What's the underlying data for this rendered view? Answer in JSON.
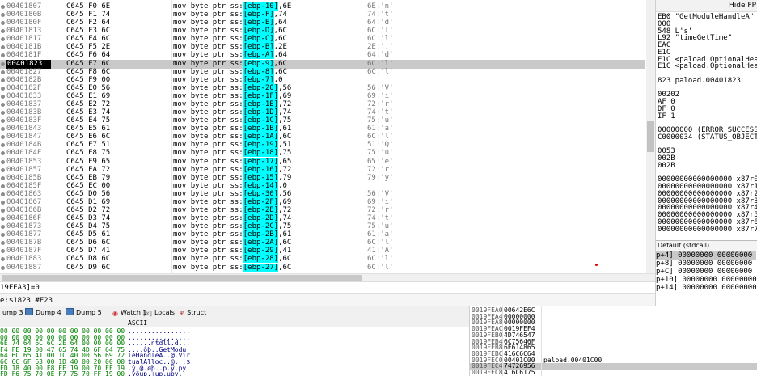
{
  "disasm": {
    "selected_index": 7,
    "rows": [
      {
        "addr": "00401807",
        "bytes": "C645 F0 6E",
        "mnemonic": "mov",
        "size": "byte ptr",
        "seg": "ss:",
        "reg": "[ebp-10]",
        "imm": ",6E",
        "comment": "6E:'n'"
      },
      {
        "addr": "0040180B",
        "bytes": "C645 F1 74",
        "mnemonic": "mov",
        "size": "byte ptr",
        "seg": "ss:",
        "reg": "[ebp-F]",
        "imm": ",74",
        "comment": "74:'t'"
      },
      {
        "addr": "0040180F",
        "bytes": "C645 F2 64",
        "mnemonic": "mov",
        "size": "byte ptr",
        "seg": "ss:",
        "reg": "[ebp-E]",
        "imm": ",64",
        "comment": "64:'d'"
      },
      {
        "addr": "00401813",
        "bytes": "C645 F3 6C",
        "mnemonic": "mov",
        "size": "byte ptr",
        "seg": "ss:",
        "reg": "[ebp-D]",
        "imm": ",6C",
        "comment": "6C:'l'"
      },
      {
        "addr": "00401817",
        "bytes": "C645 F4 6C",
        "mnemonic": "mov",
        "size": "byte ptr",
        "seg": "ss:",
        "reg": "[ebp-C]",
        "imm": ",6C",
        "comment": "6C:'l'"
      },
      {
        "addr": "0040181B",
        "bytes": "C645 F5 2E",
        "mnemonic": "mov",
        "size": "byte ptr",
        "seg": "ss:",
        "reg": "[ebp-B]",
        "imm": ",2E",
        "comment": "2E:'.'"
      },
      {
        "addr": "0040181F",
        "bytes": "C645 F6 64",
        "mnemonic": "mov",
        "size": "byte ptr",
        "seg": "ss:",
        "reg": "[ebp-A]",
        "imm": ",64",
        "comment": "64:'d'"
      },
      {
        "addr": "00401823",
        "bytes": "C645 F7 6C",
        "mnemonic": "mov",
        "size": "byte ptr",
        "seg": "ss:",
        "reg": "[ebp-9]",
        "imm": ",6C",
        "comment": "6C:'l'"
      },
      {
        "addr": "00401827",
        "bytes": "C645 F8 6C",
        "mnemonic": "mov",
        "size": "byte ptr",
        "seg": "ss:",
        "reg": "[ebp-8]",
        "imm": ",6C",
        "comment": "6C:'l'"
      },
      {
        "addr": "0040182B",
        "bytes": "C645 F9 00",
        "mnemonic": "mov",
        "size": "byte ptr",
        "seg": "ss:",
        "reg": "[ebp-7]",
        "imm": ",0",
        "comment": ""
      },
      {
        "addr": "0040182F",
        "bytes": "C645 E0 56",
        "mnemonic": "mov",
        "size": "byte ptr",
        "seg": "ss:",
        "reg": "[ebp-20]",
        "imm": ",56",
        "comment": "56:'V'"
      },
      {
        "addr": "00401833",
        "bytes": "C645 E1 69",
        "mnemonic": "mov",
        "size": "byte ptr",
        "seg": "ss:",
        "reg": "[ebp-1F]",
        "imm": ",69",
        "comment": "69:'i'"
      },
      {
        "addr": "00401837",
        "bytes": "C645 E2 72",
        "mnemonic": "mov",
        "size": "byte ptr",
        "seg": "ss:",
        "reg": "[ebp-1E]",
        "imm": ",72",
        "comment": "72:'r'"
      },
      {
        "addr": "0040183B",
        "bytes": "C645 E3 74",
        "mnemonic": "mov",
        "size": "byte ptr",
        "seg": "ss:",
        "reg": "[ebp-1D]",
        "imm": ",74",
        "comment": "74:'t'"
      },
      {
        "addr": "0040183F",
        "bytes": "C645 E4 75",
        "mnemonic": "mov",
        "size": "byte ptr",
        "seg": "ss:",
        "reg": "[ebp-1C]",
        "imm": ",75",
        "comment": "75:'u'"
      },
      {
        "addr": "00401843",
        "bytes": "C645 E5 61",
        "mnemonic": "mov",
        "size": "byte ptr",
        "seg": "ss:",
        "reg": "[ebp-1B]",
        "imm": ",61",
        "comment": "61:'a'"
      },
      {
        "addr": "00401847",
        "bytes": "C645 E6 6C",
        "mnemonic": "mov",
        "size": "byte ptr",
        "seg": "ss:",
        "reg": "[ebp-1A]",
        "imm": ",6C",
        "comment": "6C:'l'"
      },
      {
        "addr": "0040184B",
        "bytes": "C645 E7 51",
        "mnemonic": "mov",
        "size": "byte ptr",
        "seg": "ss:",
        "reg": "[ebp-19]",
        "imm": ",51",
        "comment": "51:'Q'"
      },
      {
        "addr": "0040184F",
        "bytes": "C645 E8 75",
        "mnemonic": "mov",
        "size": "byte ptr",
        "seg": "ss:",
        "reg": "[ebp-18]",
        "imm": ",75",
        "comment": "75:'u'"
      },
      {
        "addr": "00401853",
        "bytes": "C645 E9 65",
        "mnemonic": "mov",
        "size": "byte ptr",
        "seg": "ss:",
        "reg": "[ebp-17]",
        "imm": ",65",
        "comment": "65:'e'"
      },
      {
        "addr": "00401857",
        "bytes": "C645 EA 72",
        "mnemonic": "mov",
        "size": "byte ptr",
        "seg": "ss:",
        "reg": "[ebp-16]",
        "imm": ",72",
        "comment": "72:'r'"
      },
      {
        "addr": "0040185B",
        "bytes": "C645 EB 79",
        "mnemonic": "mov",
        "size": "byte ptr",
        "seg": "ss:",
        "reg": "[ebp-15]",
        "imm": ",79",
        "comment": "79:'y'"
      },
      {
        "addr": "0040185F",
        "bytes": "C645 EC 00",
        "mnemonic": "mov",
        "size": "byte ptr",
        "seg": "ss:",
        "reg": "[ebp-14]",
        "imm": ",0",
        "comment": ""
      },
      {
        "addr": "00401863",
        "bytes": "C645 D0 56",
        "mnemonic": "mov",
        "size": "byte ptr",
        "seg": "ss:",
        "reg": "[ebp-30]",
        "imm": ",56",
        "comment": "56:'V'"
      },
      {
        "addr": "00401867",
        "bytes": "C645 D1 69",
        "mnemonic": "mov",
        "size": "byte ptr",
        "seg": "ss:",
        "reg": "[ebp-2F]",
        "imm": ",69",
        "comment": "69:'i'"
      },
      {
        "addr": "0040186B",
        "bytes": "C645 D2 72",
        "mnemonic": "mov",
        "size": "byte ptr",
        "seg": "ss:",
        "reg": "[ebp-2E]",
        "imm": ",72",
        "comment": "72:'r'"
      },
      {
        "addr": "0040186F",
        "bytes": "C645 D3 74",
        "mnemonic": "mov",
        "size": "byte ptr",
        "seg": "ss:",
        "reg": "[ebp-2D]",
        "imm": ",74",
        "comment": "74:'t'"
      },
      {
        "addr": "00401873",
        "bytes": "C645 D4 75",
        "mnemonic": "mov",
        "size": "byte ptr",
        "seg": "ss:",
        "reg": "[ebp-2C]",
        "imm": ",75",
        "comment": "75:'u'"
      },
      {
        "addr": "00401877",
        "bytes": "C645 D5 61",
        "mnemonic": "mov",
        "size": "byte ptr",
        "seg": "ss:",
        "reg": "[ebp-2B]",
        "imm": ",61",
        "comment": "61:'a'"
      },
      {
        "addr": "0040187B",
        "bytes": "C645 D6 6C",
        "mnemonic": "mov",
        "size": "byte ptr",
        "seg": "ss:",
        "reg": "[ebp-2A]",
        "imm": ",6C",
        "comment": "6C:'l'"
      },
      {
        "addr": "0040187F",
        "bytes": "C645 D7 41",
        "mnemonic": "mov",
        "size": "byte ptr",
        "seg": "ss:",
        "reg": "[ebp-29]",
        "imm": ",41",
        "comment": "41:'A'"
      },
      {
        "addr": "00401883",
        "bytes": "C645 D8 6C",
        "mnemonic": "mov",
        "size": "byte ptr",
        "seg": "ss:",
        "reg": "[ebp-28]",
        "imm": ",6C",
        "comment": "6C:'l'"
      },
      {
        "addr": "00401887",
        "bytes": "C645 D9 6C",
        "mnemonic": "mov",
        "size": "byte ptr",
        "seg": "ss:",
        "reg": "[ebp-27]",
        "imm": ",6C",
        "comment": "6C:'l'"
      }
    ]
  },
  "info": {
    "line1": "19FEA3]=0",
    "line2": "e:$1823 #F23"
  },
  "registers": {
    "hide_fpu_label": "Hide FP",
    "lines": [
      {
        "text": "EB0    \"GetModuleHandleA\""
      },
      {
        "text": "000"
      },
      {
        "text": "548    L's'"
      },
      {
        "text": "L92    \"timeGetTime\""
      },
      {
        "text": "EAC"
      },
      {
        "text": "E1C"
      },
      {
        "text": "E1C    <paload.OptionalHea"
      },
      {
        "text": "E1C    <paload.OptionalHea"
      },
      {
        "text": ""
      },
      {
        "text": "823    paload.00401823"
      },
      {
        "text": ""
      },
      {
        "text": "00202"
      },
      {
        "text": " AF 0"
      },
      {
        "text": " DF 0"
      },
      {
        "text": " IF 1"
      },
      {
        "text": ""
      },
      {
        "text": "00000000 (ERROR_SUCCESS)"
      },
      {
        "text": "C0000034 (STATUS_OBJECT_NAM"
      },
      {
        "text": ""
      },
      {
        "text": " 0053"
      },
      {
        "text": " 002B"
      },
      {
        "text": " 002B"
      },
      {
        "text": ""
      },
      {
        "text": "00000000000000000 x87r0 Empty"
      },
      {
        "text": "00000000000000000 x87r1 Empty"
      },
      {
        "text": "00000000000000000 x87r2 Empty"
      },
      {
        "text": "00000000000000000 x87r3 Empty"
      },
      {
        "text": "00000000000000000 x87r4 Empty"
      },
      {
        "text": "00000000000000000 x87r5 Empty"
      },
      {
        "text": "00000000000000000 x87r6 Empty"
      },
      {
        "text": "00000000000000000 x87r7 Empty"
      }
    ]
  },
  "callstack": {
    "title": "Default (stdcall)",
    "rows": [
      {
        "text": "p+4]  00000000  00000000"
      },
      {
        "text": "p+8]  00000000  00000000"
      },
      {
        "text": "p+C]  00000000  00000000"
      },
      {
        "text": "p+10]  00000000  00000000"
      },
      {
        "text": "p+14]  00000000  00000000"
      }
    ]
  },
  "tabs": [
    {
      "label": "ump 3",
      "icon": "none"
    },
    {
      "label": "Dump 4",
      "icon": "dump-icon"
    },
    {
      "label": "Dump 5",
      "icon": "dump-icon"
    },
    {
      "label": "Watch 1",
      "icon": "watch-icon"
    },
    {
      "label": "Locals",
      "icon": "locals-icon"
    },
    {
      "label": "Struct",
      "icon": "struct-icon"
    }
  ],
  "dump": {
    "ascii_header": "ASCII",
    "rows": [
      {
        "hex": "00 00 00 00 00 00 00 00 00 00 00",
        "ascii": "................"
      },
      {
        "hex": "00 00 00 00 00 00 00 00 00 00 00",
        "ascii": "................"
      },
      {
        "hex": "6E 74 64 6C 6C 2E 64 00 00 00 00",
        "ascii": "......ntdll.d..."
      },
      {
        "hex": "F4 FE 19 00 47 65 74 4D 6F 64 75",
        "ascii": "....ôþ..GetModu"
      },
      {
        "hex": "64 6C 65 41 00 1C 40 00 56 69 72",
        "ascii": "leHandleA..@.Vir"
      },
      {
        "hex": "6C 6C 6F 63 00 1D 40 00 20 00 00",
        "ascii": "tualAlloc..@. .$"
      },
      {
        "hex": "FD 18 40 00 F8 FE 19 00 70 FF 19",
        "ascii": ".ý.@.øþ..p.ÿ.py."
      },
      {
        "hex": "FD F6 75 70 0E F7 75 70 FF 19 00",
        "ascii": ".ýöup.÷up.upv."
      }
    ]
  },
  "stack": {
    "selected_index": 9,
    "rows": [
      {
        "addr": "0019FEA0",
        "val": "00642E6C",
        "cmt": ""
      },
      {
        "addr": "0019FEA4",
        "val": "00000000",
        "cmt": ""
      },
      {
        "addr": "0019FEA8",
        "val": "00000000",
        "cmt": ""
      },
      {
        "addr": "0019FEAC",
        "val": "0019FEF4",
        "cmt": ""
      },
      {
        "addr": "0019FEB0",
        "val": "4D746547",
        "cmt": ""
      },
      {
        "addr": "0019FEB4",
        "val": "6C75646F",
        "cmt": ""
      },
      {
        "addr": "0019FEB8",
        "val": "6E614865",
        "cmt": ""
      },
      {
        "addr": "0019FEBC",
        "val": "416C6C64",
        "cmt": ""
      },
      {
        "addr": "0019FEC0",
        "val": "00401C00",
        "cmt": "paload.00401C00"
      },
      {
        "addr": "0019FEC4",
        "val": "74726956",
        "cmt": ""
      },
      {
        "addr": "0019FEC8",
        "val": "416C6175",
        "cmt": ""
      }
    ]
  },
  "colors": {
    "selection": "#c9c9c9",
    "register_highlight": "#00ffff",
    "address": "#777777",
    "hex": "#008000",
    "ascii": "#000080"
  }
}
